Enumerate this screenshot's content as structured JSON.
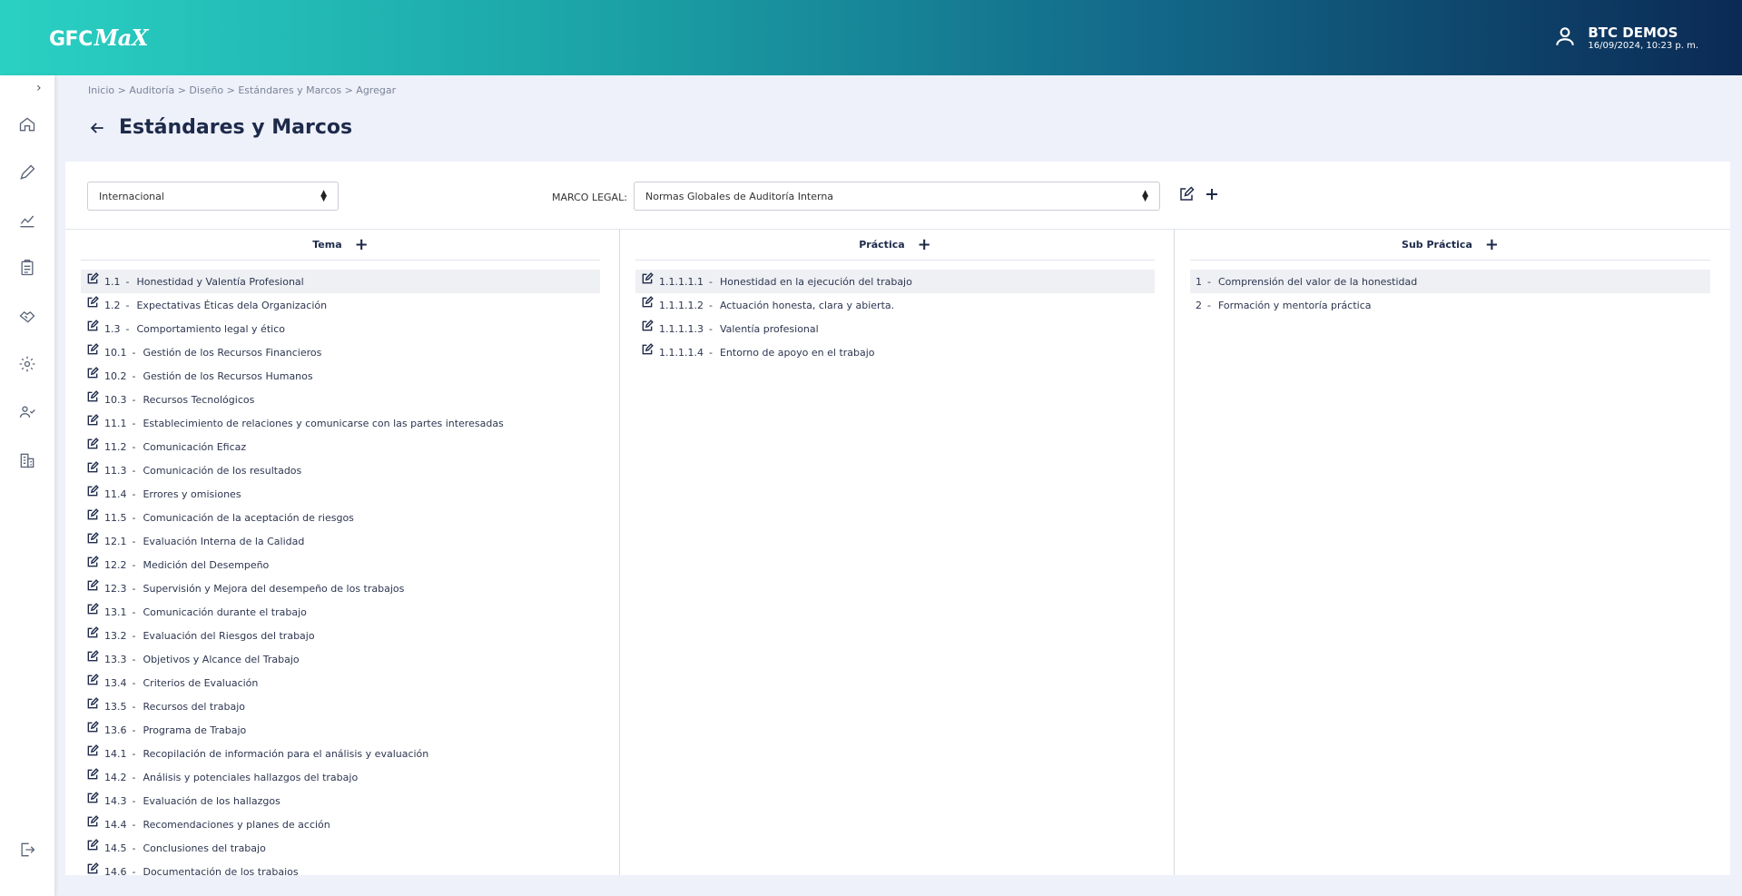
{
  "header": {
    "logo_main": "GFC",
    "logo_script": "MaX",
    "user_name": "BTC DEMOS",
    "user_date": "16/09/2024, 10:23 p. m."
  },
  "sidebar": {
    "items": [
      "home-icon",
      "pencil-icon",
      "chart-icon",
      "clipboard-icon",
      "handshake-icon",
      "gear-icon",
      "users-icon",
      "building-icon"
    ],
    "logout": "logout-icon"
  },
  "breadcrumb": "Inicio > Auditoría > Diseño > Estándares y Marcos > Agregar",
  "page_title": "Estándares y Marcos",
  "filters": {
    "scope_value": "Internacional",
    "marco_label": "MARCO LEGAL:",
    "marco_value": "Normas Globales de Auditoría Interna"
  },
  "columns": {
    "tema": {
      "title": "Tema",
      "items": [
        {
          "code": "1.1",
          "label": "Honestidad y Valentía Profesional"
        },
        {
          "code": "1.2",
          "label": "Expectativas Éticas dela Organización"
        },
        {
          "code": "1.3",
          "label": "Comportamiento legal y ético"
        },
        {
          "code": "10.1",
          "label": "Gestión de los Recursos Financieros"
        },
        {
          "code": "10.2",
          "label": "Gestión de los Recursos Humanos"
        },
        {
          "code": "10.3",
          "label": "Recursos Tecnológicos"
        },
        {
          "code": "11.1",
          "label": "Establecimiento de relaciones y comunicarse con las partes interesadas"
        },
        {
          "code": "11.2",
          "label": "Comunicación Eficaz"
        },
        {
          "code": "11.3",
          "label": "Comunicación de los resultados"
        },
        {
          "code": "11.4",
          "label": "Errores y omisiones"
        },
        {
          "code": "11.5",
          "label": "Comunicación de la aceptación de riesgos"
        },
        {
          "code": "12.1",
          "label": "Evaluación Interna de la Calidad"
        },
        {
          "code": "12.2",
          "label": "Medición del Desempeño"
        },
        {
          "code": "12.3",
          "label": "Supervisión y Mejora del desempeño de los trabajos"
        },
        {
          "code": "13.1",
          "label": "Comunicación durante el trabajo"
        },
        {
          "code": "13.2",
          "label": "Evaluación del Riesgos del trabajo"
        },
        {
          "code": "13.3",
          "label": "Objetivos y Alcance del Trabajo"
        },
        {
          "code": "13.4",
          "label": "Criterios de Evaluación"
        },
        {
          "code": "13.5",
          "label": "Recursos del trabajo"
        },
        {
          "code": "13.6",
          "label": "Programa de Trabajo"
        },
        {
          "code": "14.1",
          "label": "Recopilación de información para el análisis y evaluación"
        },
        {
          "code": "14.2",
          "label": "Análisis y potenciales hallazgos del trabajo"
        },
        {
          "code": "14.3",
          "label": "Evaluación de los hallazgos"
        },
        {
          "code": "14.4",
          "label": "Recomendaciones y planes de acción"
        },
        {
          "code": "14.5",
          "label": "Conclusiones del trabajo"
        },
        {
          "code": "14.6",
          "label": "Documentación de los trabajos"
        }
      ]
    },
    "practica": {
      "title": "Práctica",
      "items": [
        {
          "code": "1.1.1.1.1",
          "label": "Honestidad en la ejecución del trabajo"
        },
        {
          "code": "1.1.1.1.2",
          "label": "Actuación honesta, clara y abierta."
        },
        {
          "code": "1.1.1.1.3",
          "label": "Valentía profesional"
        },
        {
          "code": "1.1.1.1.4",
          "label": "Entorno de apoyo en el trabajo"
        }
      ]
    },
    "subpractica": {
      "title": "Sub Práctica",
      "items": [
        {
          "code": "1",
          "label": "Comprensión del valor de la honestidad"
        },
        {
          "code": "2",
          "label": "Formación y mentoría práctica"
        }
      ]
    }
  }
}
